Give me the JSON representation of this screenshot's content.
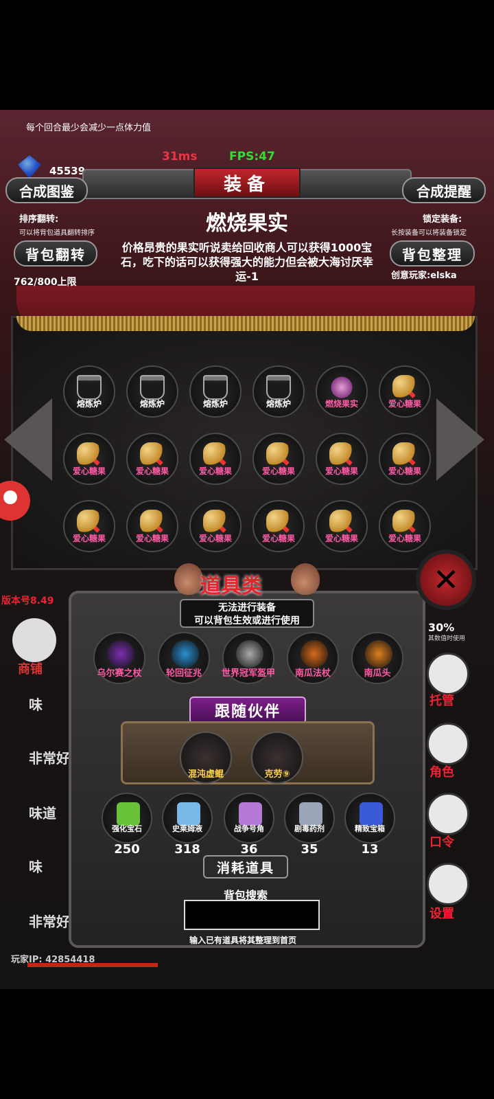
{
  "status": {
    "tip": "每个回合最少会减少一点体力值",
    "ping": "31ms",
    "fps": "FPS:47",
    "gems": "45539"
  },
  "header": {
    "title": "装备",
    "left_button": "合成图鉴",
    "right_button": "合成提醒",
    "sort_label": "排序翻转:",
    "sort_sub": "可以将背包道具翻转排序",
    "lock_label": "锁定装备:",
    "lock_sub": "长按装备可以将装备锁定",
    "flip_button": "背包翻转",
    "organize_button": "背包整理",
    "capacity": "762/800上限",
    "creator": "创意玩家:elska"
  },
  "selected_item": {
    "name": "燃烧果实",
    "description": "价格昂贵的果实听说卖给回收商人可以获得1000宝石，吃下的话可以获得强大的能力但会被大海讨厌幸运-1"
  },
  "inventory": [
    {
      "name": "熔炼炉",
      "kind": "furnace",
      "color": "white"
    },
    {
      "name": "熔炼炉",
      "kind": "furnace",
      "color": "white"
    },
    {
      "name": "熔炼炉",
      "kind": "furnace",
      "color": "white"
    },
    {
      "name": "熔炼炉",
      "kind": "furnace",
      "color": "white"
    },
    {
      "name": "燃烧果实",
      "kind": "fruit",
      "color": "pink"
    },
    {
      "name": "爱心糖果",
      "kind": "candy",
      "color": "pink"
    },
    {
      "name": "爱心糖果",
      "kind": "candy",
      "color": "pink"
    },
    {
      "name": "爱心糖果",
      "kind": "candy",
      "color": "pink"
    },
    {
      "name": "爱心糖果",
      "kind": "candy",
      "color": "pink"
    },
    {
      "name": "爱心糖果",
      "kind": "candy",
      "color": "pink"
    },
    {
      "name": "爱心糖果",
      "kind": "candy",
      "color": "pink"
    },
    {
      "name": "爱心糖果",
      "kind": "candy",
      "color": "pink"
    },
    {
      "name": "爱心糖果",
      "kind": "candy",
      "color": "pink"
    },
    {
      "name": "爱心糖果",
      "kind": "candy",
      "color": "pink"
    },
    {
      "name": "爱心糖果",
      "kind": "candy",
      "color": "pink"
    },
    {
      "name": "爱心糖果",
      "kind": "candy",
      "color": "pink"
    },
    {
      "name": "爱心糖果",
      "kind": "candy",
      "color": "pink"
    },
    {
      "name": "爱心糖果",
      "kind": "candy",
      "color": "pink"
    }
  ],
  "version": "版本号8.49",
  "popup": {
    "category": "道具类",
    "note_line1": "无法进行装备",
    "note_line2": "可以背包生效或进行使用",
    "items": [
      {
        "name": "乌尔赛之杖",
        "color": "#7a2fb0"
      },
      {
        "name": "轮回征兆",
        "color": "#2a8fd0"
      },
      {
        "name": "世界冠军盔甲",
        "color": "#aaaaaa"
      },
      {
        "name": "南瓜法杖",
        "color": "#d96a1a"
      },
      {
        "name": "南瓜头",
        "color": "#e0801f"
      }
    ],
    "companion_banner": "跟随伙伴",
    "companions": [
      {
        "name": "混沌虚鲲"
      },
      {
        "name": "克劳⑨"
      }
    ],
    "consumables": [
      {
        "name": "强化宝石",
        "count": "250",
        "color": "#6ac23a"
      },
      {
        "name": "史莱姆液",
        "count": "318",
        "color": "#7ab8e8"
      },
      {
        "name": "战争号角",
        "count": "36",
        "color": "#b57ad8"
      },
      {
        "name": "剧毒药剂",
        "count": "35",
        "color": "#9aa6b8"
      },
      {
        "name": "精致宝箱",
        "count": "13",
        "color": "#3a5ad8"
      }
    ],
    "consumables_banner": "消耗道具",
    "search_label": "背包搜索",
    "search_value": "",
    "search_hint": "输入已有道具将其整理到首页"
  },
  "background": {
    "shop_label": "商铺",
    "list": [
      "味",
      "非常好",
      "味道",
      "味",
      "非常好处的的糖果"
    ],
    "player_ip": "玩家IP: 42854418",
    "percent": "30%",
    "percent_sub": "其数值时使用",
    "right_buttons": [
      "托管",
      "角色",
      "口令",
      "设置"
    ]
  }
}
